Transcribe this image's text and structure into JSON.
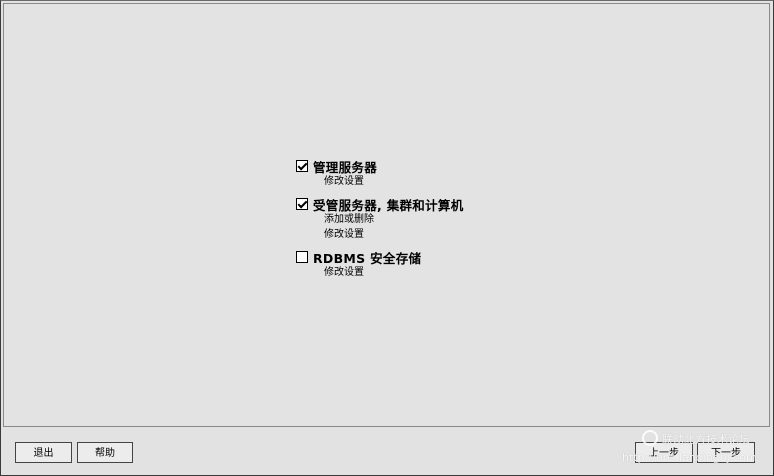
{
  "options": [
    {
      "title": "管理服务器",
      "checked": true,
      "actions": [
        "修改设置"
      ]
    },
    {
      "title": "受管服务器, 集群和计算机",
      "checked": true,
      "actions": [
        "添加或删除",
        "修改设置"
      ]
    },
    {
      "title": "RDBMS 安全存储",
      "checked": false,
      "actions": [
        "修改设置"
      ]
    }
  ],
  "buttons": {
    "exit": "退出",
    "help": "帮助",
    "back": "上一步",
    "next": "下一步"
  },
  "watermark": {
    "text": "联动北方技术论坛",
    "url": "http://bbs.landingbj.com"
  }
}
